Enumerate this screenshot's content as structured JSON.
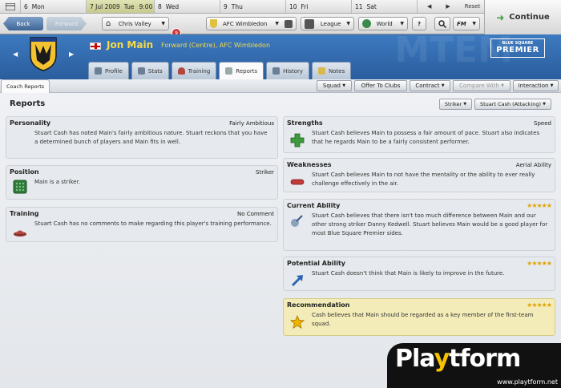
{
  "calendar": {
    "days": [
      {
        "num": "6",
        "name": "Mon"
      },
      {
        "num": "7 Jul 2009",
        "name": "Tue",
        "time": "9:00",
        "today": true
      },
      {
        "num": "8",
        "name": "Wed"
      },
      {
        "num": "9",
        "name": "Thu"
      },
      {
        "num": "10",
        "name": "Fri"
      },
      {
        "num": "11",
        "name": "Sat"
      }
    ],
    "reset_label": "Reset"
  },
  "nav": {
    "back": "Back",
    "forward": "Forward",
    "manager": "Chris Valley",
    "news_count": "9",
    "team": "AFC Wimbledon",
    "league": "League",
    "world": "World",
    "help": "?",
    "fm": "FM",
    "continue": "Continue"
  },
  "player": {
    "name": "Jon Main",
    "description": "Forward (Centre), AFC Wimbledon"
  },
  "competition": {
    "line1": "BLUE SQUARE",
    "line2": "PREMIER"
  },
  "tabs": [
    "Profile",
    "Stats",
    "Training",
    "Reports",
    "History",
    "Notes"
  ],
  "subtab": "Coach Reports",
  "actions": {
    "squad": "Squad",
    "offer": "Offer To Clubs",
    "contract": "Contract",
    "compare": "Compare With",
    "interaction": "Interaction"
  },
  "page": {
    "title": "Reports",
    "filter_position": "Striker",
    "filter_coach": "Stuart Cash (Attacking)"
  },
  "left": {
    "personality": {
      "title": "Personality",
      "value": "Fairly Ambitious",
      "text": "Stuart Cash has noted Main's fairly ambitious nature. Stuart reckons that you have a determined bunch of players and Main fits in well."
    },
    "position": {
      "title": "Position",
      "value": "Striker",
      "text": "Main is a striker."
    },
    "training": {
      "title": "Training",
      "value": "No Comment",
      "text": "Stuart Cash has no comments to make regarding this player's training performance."
    }
  },
  "right": {
    "strengths": {
      "title": "Strengths",
      "value": "Speed",
      "text": "Stuart Cash believes Main to possess a fair amount of pace. Stuart also indicates that he regards Main to be a fairly consistent performer."
    },
    "weaknesses": {
      "title": "Weaknesses",
      "value": "Aerial Ability",
      "text": "Stuart Cash believes Main to not have the mentality or the ability to ever really challenge effectively in the air."
    },
    "current": {
      "title": "Current Ability",
      "stars": 5,
      "text": "Stuart Cash believes that there isn't too much difference between Main and our other strong striker Danny Kedwell. Stuart believes Main would be a good player for most Blue Square Premier sides."
    },
    "potential": {
      "title": "Potential Ability",
      "stars": 5,
      "text": "Stuart Cash doesn't think that Main is likely to improve in the future."
    },
    "recommendation": {
      "title": "Recommendation",
      "stars": 5,
      "text": "Cash believes that Main should be regarded as a key member of the first-team squad."
    }
  },
  "watermark": {
    "brand_pre": "Pla",
    "brand_y": "y",
    "brand_post": "tform",
    "url": "www.playtform.net"
  }
}
